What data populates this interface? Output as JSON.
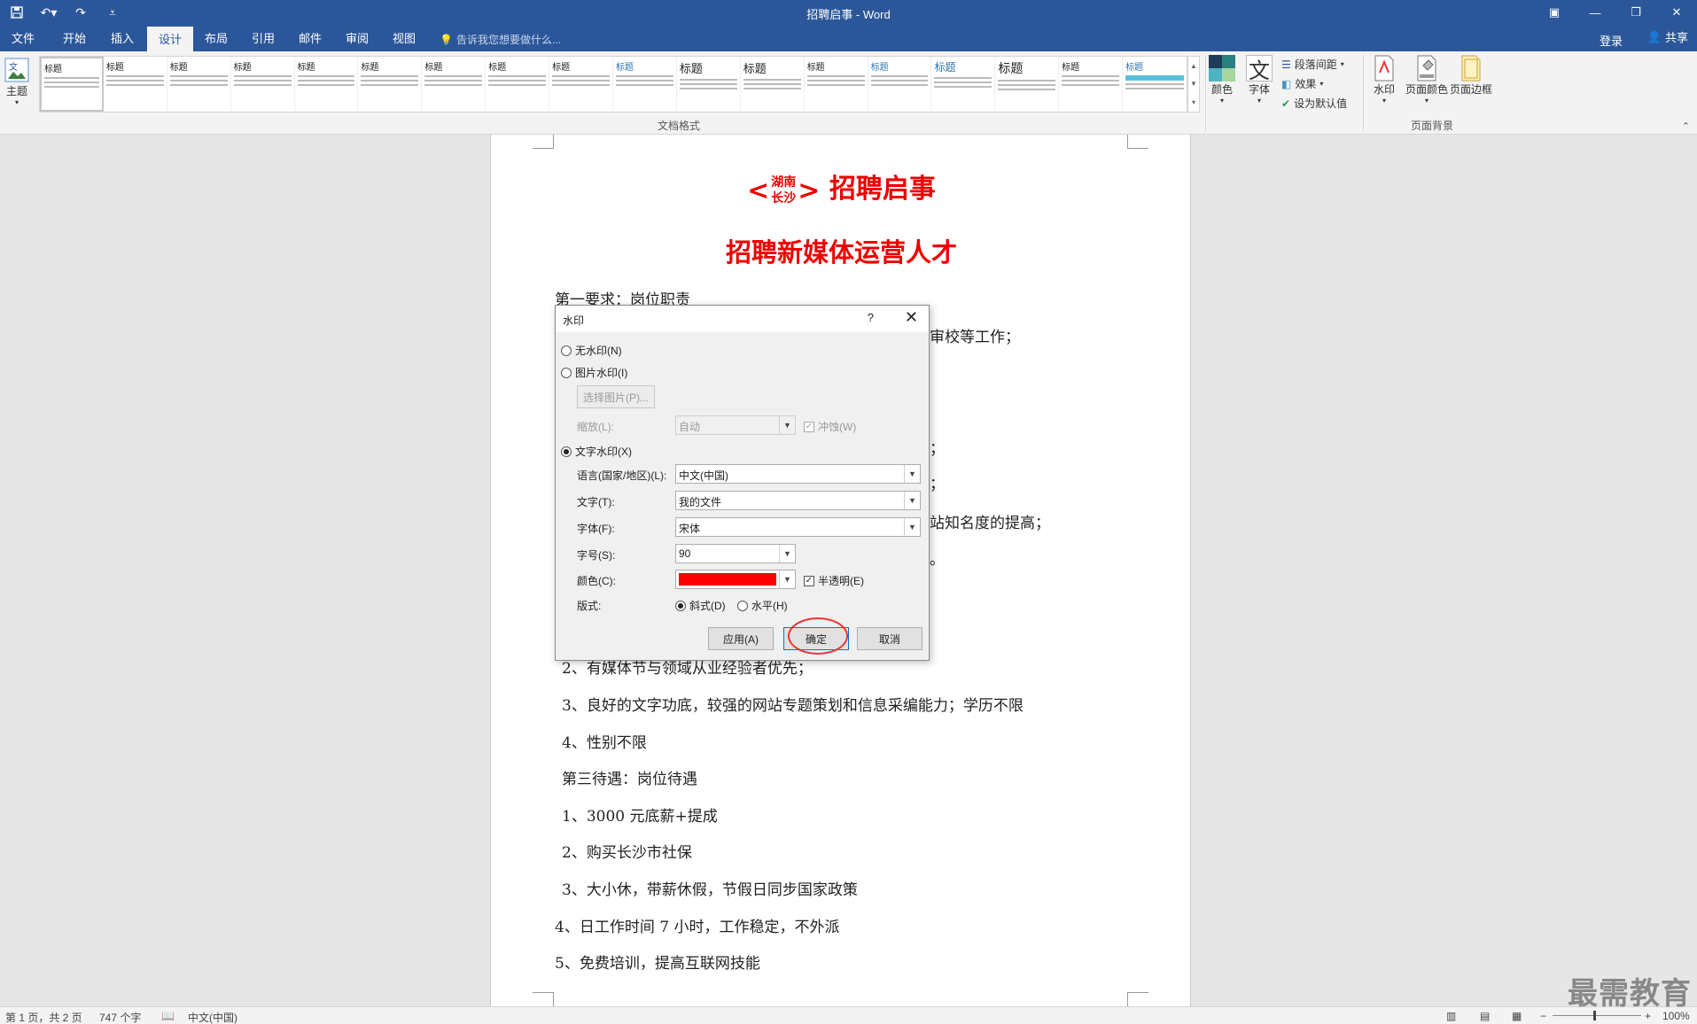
{
  "app": {
    "title": "招聘启事 - Word",
    "login": "登录",
    "share": "共享",
    "tell_me": "告诉我您想要做什么..."
  },
  "tabs": [
    "文件",
    "开始",
    "插入",
    "设计",
    "布局",
    "引用",
    "邮件",
    "审阅",
    "视图"
  ],
  "ribbon": {
    "theme_label": "主题",
    "gallery_title_text": "标题",
    "gallery_label": "文档格式",
    "colors_label": "颜色",
    "fonts_label": "字体",
    "fonts_icon_char": "文",
    "paragraph_spacing": "段落间距",
    "effects": "效果",
    "set_default": "设为默认值",
    "watermark": "水印",
    "page_color": "页面颜色",
    "page_borders": "页面边框",
    "page_bg_label": "页面背景"
  },
  "document": {
    "title_left": "<",
    "title_stack_top": "湖南",
    "title_stack_bottom": "长沙",
    "title_right": ">",
    "title_main": "招聘启事",
    "subtitle": "招聘新媒体运营人才",
    "lines": [
      "第一要求：岗位职责",
      "审校等工作；",
      "；",
      "；",
      "站知名度的提高；",
      "。",
      "2、有媒体节与领域从业经验者优先；",
      "3、良好的文字功底，较强的网站专题策划和信息采编能力；学历不限",
      "4、性别不限",
      "第三待遇：岗位待遇",
      "1、3000 元底薪+提成",
      "2、购买长沙市社保",
      "3、大小休，带薪休假，节假日同步国家政策",
      "4、日工作时间 7 小时，工作稳定，不外派",
      "5、免费培训，提高互联网技能"
    ]
  },
  "dialog": {
    "title": "水印",
    "help": "?",
    "close": "✕",
    "no_watermark": "无水印(N)",
    "picture_watermark": "图片水印(I)",
    "select_picture": "选择图片(P)...",
    "scale_label": "缩放(L):",
    "scale_value": "自动",
    "washout": "冲蚀(W)",
    "text_watermark": "文字水印(X)",
    "language_label": "语言(国家/地区)(L):",
    "language_value": "中文(中国)",
    "text_label": "文字(T):",
    "text_value": "我的文件",
    "font_label": "字体(F):",
    "font_value": "宋体",
    "size_label": "字号(S):",
    "size_value": "90",
    "color_label": "颜色(C):",
    "color_value": "#ff0000",
    "semitransparent": "半透明(E)",
    "layout_label": "版式:",
    "diagonal": "斜式(D)",
    "horizontal": "水平(H)",
    "apply": "应用(A)",
    "ok": "确定",
    "cancel": "取消",
    "selected_option": "text_watermark",
    "selected_layout": "diagonal",
    "semitransparent_checked": true,
    "washout_checked": true
  },
  "status": {
    "page": "第 1 页，共 2 页",
    "words": "747 个字",
    "language": "中文(中国)",
    "zoom": "100%"
  },
  "logo_text": "最需教育",
  "colors": {
    "brand": "#2b579a",
    "accent_red": "#e00000"
  }
}
